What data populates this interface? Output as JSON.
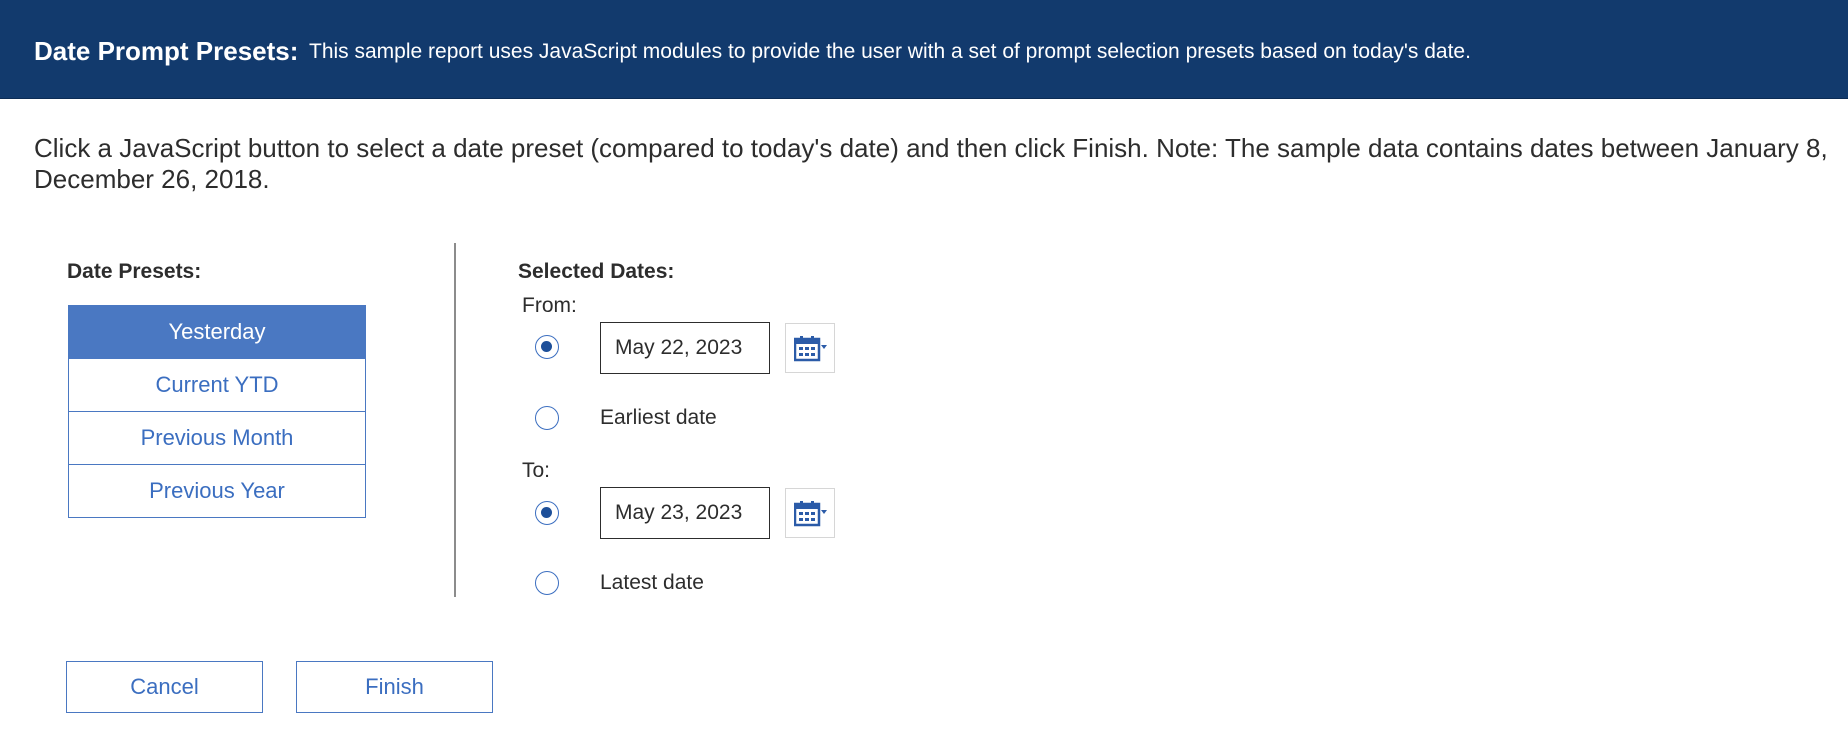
{
  "header": {
    "title": "Date Prompt Presets:",
    "description": "This sample report uses JavaScript modules to provide the user with a set of prompt selection presets based on today's date."
  },
  "intro": {
    "line1": "Click a JavaScript button to select a date preset (compared to today's date) and then click Finish. Note: The sample data contains dates between January 8,",
    "line2": "December 26, 2018."
  },
  "presets": {
    "label": "Date Presets:",
    "items": [
      {
        "label": "Yesterday",
        "selected": true
      },
      {
        "label": "Current YTD",
        "selected": false
      },
      {
        "label": "Previous Month",
        "selected": false
      },
      {
        "label": "Previous Year",
        "selected": false
      }
    ]
  },
  "selected_dates": {
    "label": "Selected Dates:",
    "from": {
      "label": "From:",
      "date_value": "May 22, 2023",
      "alt_option": "Earliest date",
      "date_selected": true,
      "calendar_icon": "calendar-dropdown-icon"
    },
    "to": {
      "label": "To:",
      "date_value": "May 23, 2023",
      "alt_option": "Latest date",
      "date_selected": true,
      "calendar_icon": "calendar-dropdown-icon"
    }
  },
  "actions": {
    "cancel_label": "Cancel",
    "finish_label": "Finish"
  },
  "colors": {
    "header_bg": "#123a6d",
    "accent": "#4a78c2",
    "link_text": "#3b6ec0"
  }
}
